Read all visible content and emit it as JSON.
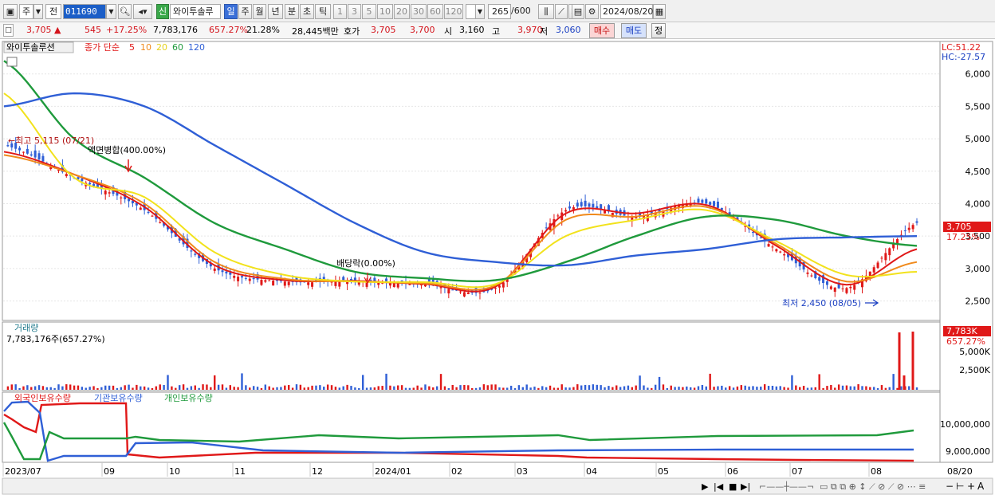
{
  "toolbar": {
    "type_a": "주",
    "type_b": "전",
    "code": "011690",
    "name": "와이투솔루",
    "new_badge": "신",
    "periods": [
      "일",
      "주",
      "월",
      "년",
      "분",
      "초",
      "틱"
    ],
    "period_selected": "일",
    "intervals": [
      "1",
      "3",
      "5",
      "10",
      "20",
      "30",
      "60",
      "120"
    ],
    "count": "265",
    "count_max": "/600",
    "date": "2024/08/20"
  },
  "quote": {
    "price": "3,705",
    "change": "545",
    "change_pct": "+17.25%",
    "volume": "7,783,176",
    "volume_ratio": "657.27%",
    "turnover_pct": "21.28%",
    "amount": "28,445백만",
    "bidask_label": "호가",
    "ask": "3,705",
    "bid": "3,700",
    "open_label": "시",
    "open": "3,160",
    "high_label": "고",
    "high": "3,970",
    "low_label": "저",
    "low": "3,060",
    "buy_label": "매수",
    "sell_label": "매도",
    "correction_label": "정"
  },
  "price_panel": {
    "stock_label": "와이투솔루션",
    "series_label": "종가 단순",
    "ma_labels": [
      "5",
      "10",
      "20",
      "60",
      "120"
    ],
    "lc": "LC:51.22",
    "hc": "HC:-27.57",
    "y_ticks": [
      "6,000",
      "5,500",
      "5,000",
      "4,500",
      "4,000",
      "3,500",
      "3,000",
      "2,500"
    ],
    "current_price_tag": "3,705",
    "current_pct_tag": "17.25%",
    "high_annotation": "최고 5,115 (07/21)",
    "low_annotation": "최저 2,450 (08/05)",
    "event_merge": "액면병합(400.00%)",
    "event_dividend": "배당락(0.00%)"
  },
  "volume_panel": {
    "title": "거래량",
    "value_text": "7,783,176주(657.27%)",
    "tag": "7,783K",
    "tag_pct": "657.27%",
    "y_ticks": [
      "5,000K",
      "2,500K"
    ]
  },
  "holding_panel": {
    "foreign_label": "외국인보유수량",
    "inst_label": "기관보유수량",
    "indiv_label": "개인보유수량",
    "y_ticks": [
      "10,000,000",
      "9,000,000"
    ]
  },
  "x_axis": {
    "labels": [
      "2023/07",
      "09",
      "10",
      "11",
      "12",
      "2024/01",
      "02",
      "03",
      "04",
      "05",
      "06",
      "07",
      "08"
    ],
    "corner": "08/20"
  },
  "colors": {
    "ma5": "#e01818",
    "ma10": "#f08a1c",
    "ma20": "#f2e21c",
    "ma60": "#1f9a3c",
    "ma120": "#2f5fd6",
    "up": "#e01818",
    "down": "#2f5fd6"
  },
  "chart_data": {
    "type": "line",
    "title": "와이투솔루션",
    "ylim": [
      2200,
      6500
    ],
    "x": [
      "2023/07",
      "09",
      "10",
      "11",
      "12",
      "2024/01",
      "02",
      "03",
      "04",
      "05",
      "06",
      "07",
      "08"
    ],
    "series": [
      {
        "name": "종가",
        "values": [
          4900,
          4400,
          3900,
          3000,
          2800,
          2800,
          2750,
          2700,
          3900,
          3800,
          4000,
          3300,
          2700,
          3705
        ]
      },
      {
        "name": "5",
        "values": [
          4800,
          4450,
          3950,
          3050,
          2820,
          2810,
          2760,
          2720,
          3850,
          3850,
          3980,
          3350,
          2750,
          3300
        ]
      },
      {
        "name": "10",
        "values": [
          4750,
          4450,
          4000,
          3100,
          2840,
          2800,
          2770,
          2740,
          3750,
          3800,
          3950,
          3380,
          2800,
          3100
        ]
      },
      {
        "name": "20",
        "values": [
          5700,
          4400,
          4100,
          3250,
          2900,
          2800,
          2790,
          2760,
          3500,
          3750,
          3900,
          3420,
          2900,
          2950
        ]
      },
      {
        "name": "60",
        "values": [
          6200,
          5000,
          4400,
          3700,
          3300,
          2950,
          2850,
          2820,
          3100,
          3500,
          3800,
          3750,
          3500,
          3350
        ]
      },
      {
        "name": "120",
        "values": [
          5500,
          5700,
          5500,
          4900,
          4300,
          3700,
          3250,
          3100,
          3050,
          3200,
          3300,
          3450,
          3480,
          3500
        ]
      }
    ]
  }
}
